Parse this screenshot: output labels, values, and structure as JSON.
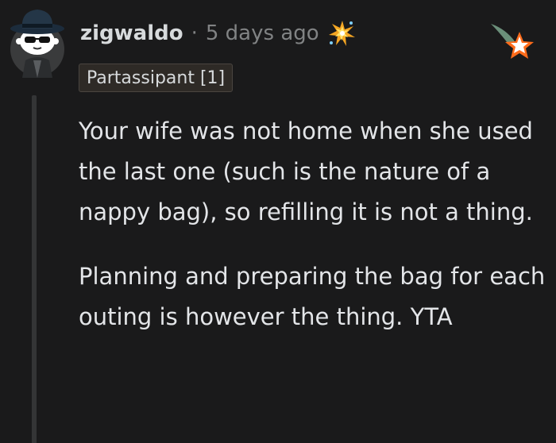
{
  "comment": {
    "username": "zigwaldo",
    "separator": "·",
    "timestamp": "5 days ago",
    "flair": "Partassipant [1]",
    "paragraphs": [
      "Your wife was not home when she used the last one (such is the nature of a nappy bag), so refilling it is not a thing.",
      "Planning and preparing the bag for each outing is however the thing. YTA"
    ],
    "awards": [
      "burst-award-icon",
      "star-award-icon"
    ]
  },
  "colors": {
    "background": "#1a1a1b",
    "text": "#d7dadc",
    "muted": "#818384",
    "flair_bg": "#2e2a26",
    "star_orange": "#ff6b1a"
  }
}
